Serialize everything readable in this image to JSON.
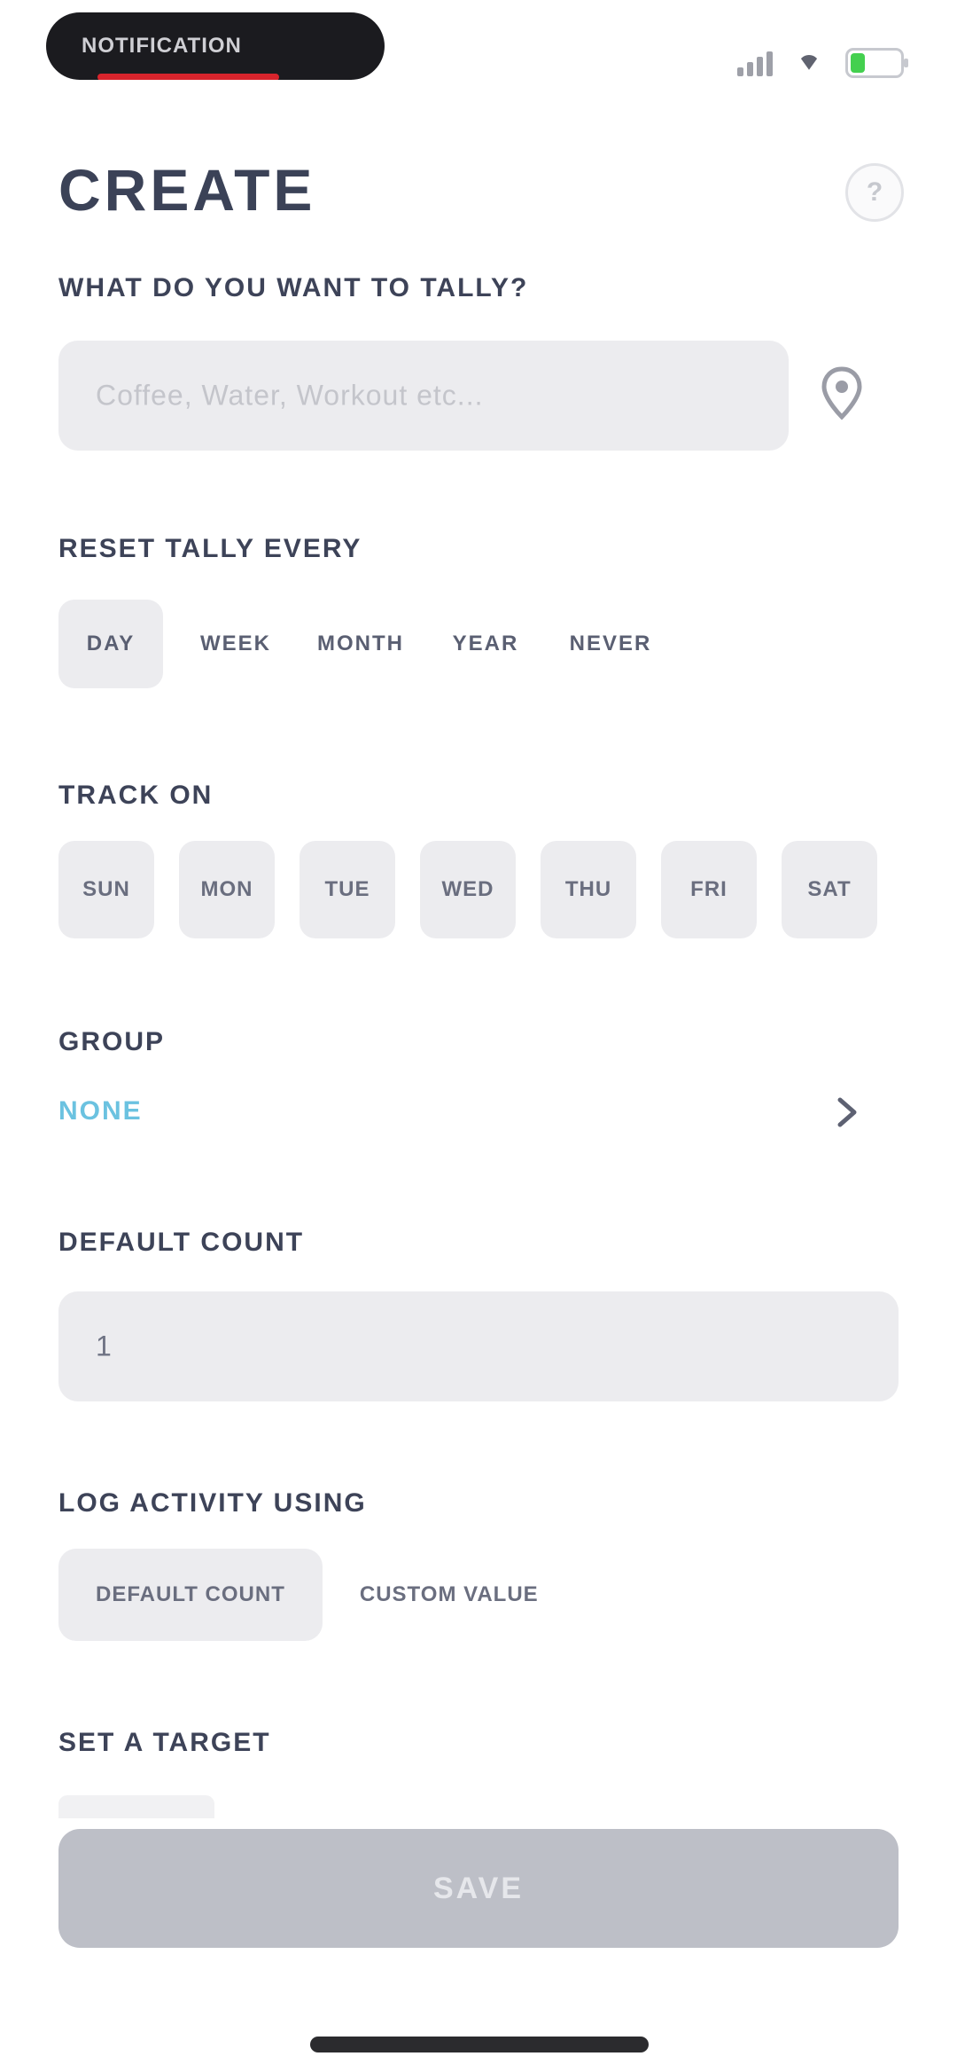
{
  "status_bar": {
    "notification_text": "NOTIFICATION",
    "colors": {
      "battery_fill": "#44d04f",
      "pill_strip": "#d8242c"
    },
    "icons": [
      "signal-icon",
      "wifi-icon",
      "battery-icon"
    ]
  },
  "header": {
    "title": "CREATE",
    "help_label": "?"
  },
  "tally_name": {
    "label": "WHAT DO YOU WANT TO TALLY?",
    "placeholder": "Coffee, Water, Workout etc..."
  },
  "reset": {
    "label": "RESET TALLY EVERY",
    "options": [
      "DAY",
      "WEEK",
      "MONTH",
      "YEAR",
      "NEVER"
    ],
    "selected": "DAY"
  },
  "track_on": {
    "label": "TRACK ON",
    "days": [
      "SUN",
      "MON",
      "TUE",
      "WED",
      "THU",
      "FRI",
      "SAT"
    ]
  },
  "group": {
    "label": "GROUP",
    "value": "NONE",
    "color": "#6bc2e0"
  },
  "default_count": {
    "label": "DEFAULT COUNT",
    "value": "1"
  },
  "log_activity": {
    "label": "LOG ACTIVITY USING",
    "options": [
      "DEFAULT COUNT",
      "CUSTOM VALUE"
    ],
    "selected": "DEFAULT COUNT"
  },
  "target": {
    "label": "SET A TARGET"
  },
  "save": {
    "label": "SAVE"
  }
}
